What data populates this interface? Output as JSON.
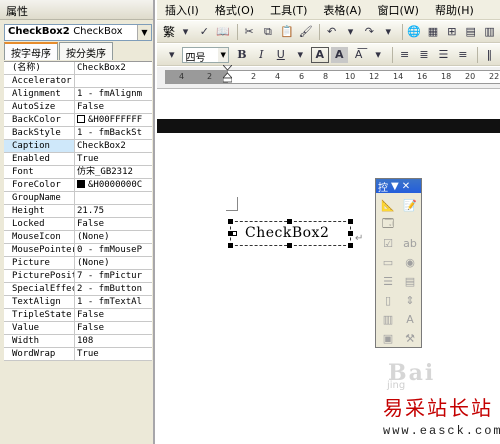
{
  "properties_panel": {
    "title": "属性",
    "object_name": "CheckBox2",
    "object_type": "CheckBox",
    "tabs": [
      "按字母序",
      "按分类序"
    ],
    "rows": [
      {
        "name": "(名称)",
        "value": "CheckBox2"
      },
      {
        "name": "Accelerator",
        "value": ""
      },
      {
        "name": "Alignment",
        "value": "1 - fmAlignm"
      },
      {
        "name": "AutoSize",
        "value": "False"
      },
      {
        "name": "BackColor",
        "value": "&H00FFFFFF"
      },
      {
        "name": "BackStyle",
        "value": "1 - fmBackSt"
      },
      {
        "name": "Caption",
        "value": "CheckBox2"
      },
      {
        "name": "Enabled",
        "value": "True"
      },
      {
        "name": "Font",
        "value": "仿宋_GB2312"
      },
      {
        "name": "ForeColor",
        "value": "&H0000000C"
      },
      {
        "name": "GroupName",
        "value": ""
      },
      {
        "name": "Height",
        "value": "21.75"
      },
      {
        "name": "Locked",
        "value": "False"
      },
      {
        "name": "MouseIcon",
        "value": "(None)"
      },
      {
        "name": "MousePointer",
        "value": "0 - fmMouseP"
      },
      {
        "name": "Picture",
        "value": "(None)"
      },
      {
        "name": "PicturePositi",
        "value": "7 - fmPictur"
      },
      {
        "name": "SpecialEffect",
        "value": "2 - fmButton"
      },
      {
        "name": "TextAlign",
        "value": "1 - fmTextAl"
      },
      {
        "name": "TripleState",
        "value": "False"
      },
      {
        "name": "Value",
        "value": "False"
      },
      {
        "name": "Width",
        "value": "108"
      },
      {
        "name": "WordWrap",
        "value": "True"
      }
    ],
    "selected_row": "Caption",
    "backcolor_swatch": "#ffffff",
    "forecolor_swatch": "#000000"
  },
  "menubar": {
    "items": [
      "插入(I)",
      "格式(O)",
      "工具(T)",
      "表格(A)",
      "窗口(W)",
      "帮助(H)"
    ]
  },
  "toolbar2": {
    "font_size": "四号",
    "char_label": "繁"
  },
  "ruler": {
    "ticks": [
      "4",
      "2",
      "2",
      "4",
      "6",
      "8",
      "10",
      "12",
      "14",
      "16",
      "18",
      "20",
      "22"
    ]
  },
  "document": {
    "checkbox_caption": "CheckBox2"
  },
  "toolbox": {
    "title": "控"
  },
  "watermark": {
    "brand": "易采站长站",
    "url": "www.easck.com",
    "logo_text": "Bai",
    "logo_sub": "jing"
  },
  "colors": {
    "panel_bg": "#ece9d8",
    "selected_row": "#cfe8fa",
    "toolbox_title": "#245edb",
    "brand_red": "#c40000"
  }
}
